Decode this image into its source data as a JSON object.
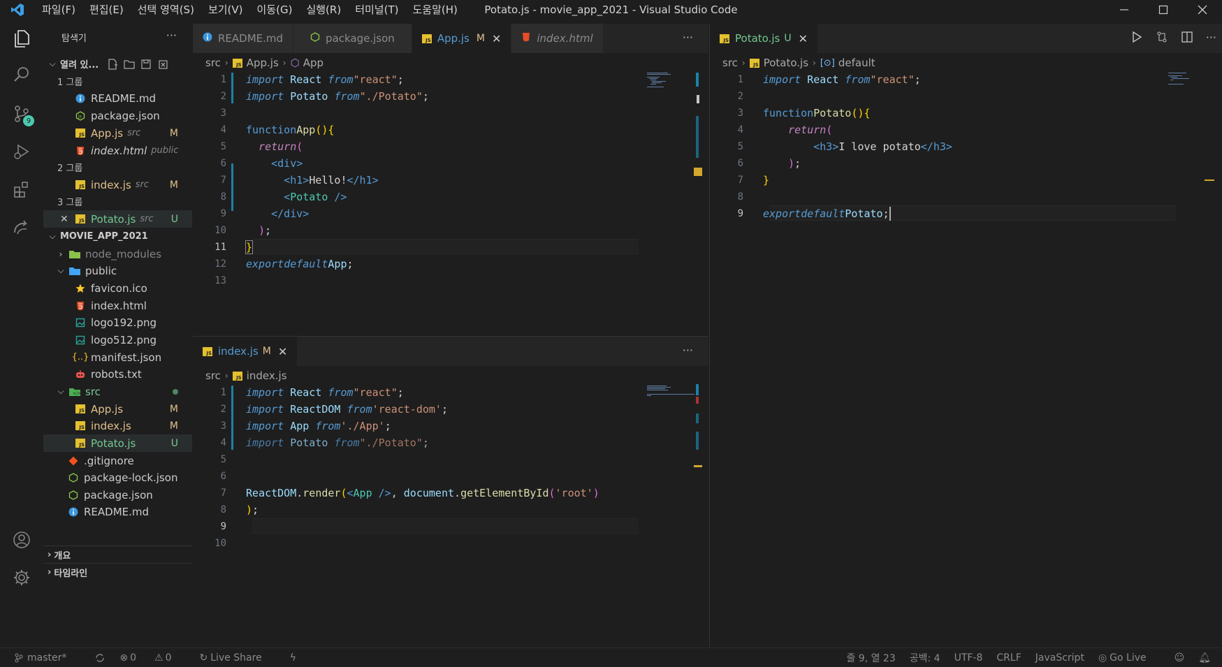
{
  "window": {
    "title": "Potato.js - movie_app_2021 - Visual Studio Code",
    "menu": [
      "파일(F)",
      "편집(E)",
      "선택 영역(S)",
      "보기(V)",
      "이동(G)",
      "실행(R)",
      "터미널(T)",
      "도움말(H)"
    ]
  },
  "activity": {
    "scm_badge": "9"
  },
  "explorer": {
    "title": "탐색기",
    "open_editors_label": "열려 있...",
    "group1_label": "1 그룹",
    "group2_label": "2 그룹",
    "group3_label": "3 그룹",
    "open_editors": [
      {
        "name": "README.md",
        "hint": "",
        "status": ""
      },
      {
        "name": "package.json",
        "hint": "",
        "status": ""
      },
      {
        "name": "App.js",
        "hint": "src",
        "status": "M"
      },
      {
        "name": "index.html",
        "hint": "public",
        "status": ""
      },
      {
        "name": "index.js",
        "hint": "src",
        "status": "M"
      },
      {
        "name": "Potato.js",
        "hint": "src",
        "status": "U"
      }
    ],
    "project_label": "MOVIE_APP_2021",
    "tree": [
      {
        "name": "node_modules"
      },
      {
        "name": "public"
      },
      {
        "name": "favicon.ico"
      },
      {
        "name": "index.html"
      },
      {
        "name": "logo192.png"
      },
      {
        "name": "logo512.png"
      },
      {
        "name": "manifest.json"
      },
      {
        "name": "robots.txt"
      },
      {
        "name": "src"
      },
      {
        "name": "App.js",
        "status": "M"
      },
      {
        "name": "index.js",
        "status": "M"
      },
      {
        "name": "Potato.js",
        "status": "U"
      },
      {
        "name": ".gitignore"
      },
      {
        "name": "package-lock.json"
      },
      {
        "name": "package.json"
      },
      {
        "name": "README.md"
      }
    ],
    "outline_label": "개요",
    "timeline_label": "타임라인"
  },
  "editor_left_top": {
    "tabs": [
      {
        "name": "README.md",
        "status": ""
      },
      {
        "name": "package.json",
        "status": ""
      },
      {
        "name": "App.js",
        "status": "M"
      },
      {
        "name": "index.html",
        "status": ""
      }
    ],
    "breadcrumb": [
      "src",
      "App.js",
      "App"
    ],
    "line_numbers": [
      "1",
      "2",
      "3",
      "4",
      "5",
      "6",
      "7",
      "8",
      "9",
      "10",
      "11",
      "12",
      "13"
    ]
  },
  "editor_left_bottom": {
    "tab": {
      "name": "index.js",
      "status": "M"
    },
    "breadcrumb": [
      "src",
      "index.js"
    ],
    "line_numbers": [
      "1",
      "2",
      "3",
      "4",
      "5",
      "6",
      "7",
      "8",
      "9",
      "10"
    ]
  },
  "editor_right": {
    "tab": {
      "name": "Potato.js",
      "status": "U"
    },
    "breadcrumb": [
      "src",
      "Potato.js",
      "default"
    ],
    "line_numbers": [
      "1",
      "2",
      "3",
      "4",
      "5",
      "6",
      "7",
      "8",
      "9"
    ]
  },
  "statusbar": {
    "branch": "master*",
    "errors": "0",
    "warnings": "0",
    "live_share": "Live Share",
    "position": "줄 9, 열 23",
    "spaces": "공백: 4",
    "encoding": "UTF-8",
    "eol": "CRLF",
    "language": "JavaScript",
    "go_live": "Go Live"
  },
  "colors": {
    "background": "#1e1e1e",
    "keyword": "#569cd6",
    "string": "#ce9178",
    "modified": "#e2c08d",
    "untracked": "#73c991",
    "js_icon": "#e5c02f"
  }
}
